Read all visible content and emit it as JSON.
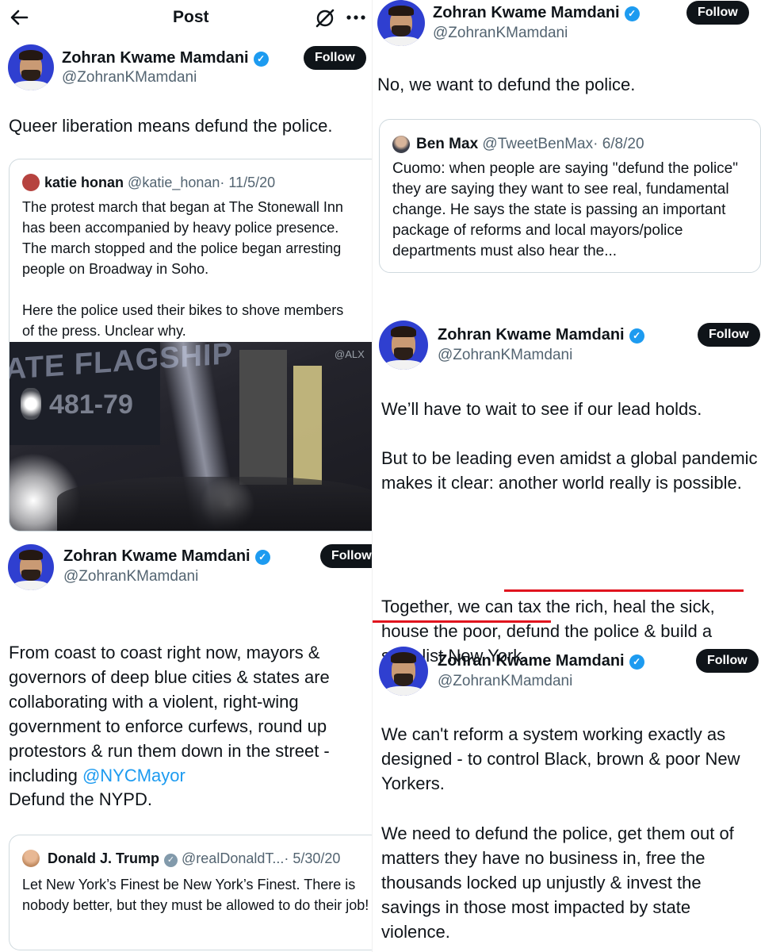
{
  "header": {
    "title": "Post",
    "back_icon": "arrow-left-icon",
    "grok_icon": "grok-icon",
    "more_icon": "more-icon"
  },
  "author": {
    "name": "Zohran Kwame Mamdani",
    "handle": "@ZohranKMamdani",
    "follow_label": "Follow"
  },
  "tweet1": {
    "text": "Queer liberation means defund the police.",
    "quote": {
      "name": "katie honan",
      "handle": "@katie_honan",
      "date": "· 11/5/20",
      "text": "The protest march that began at The Stonewall Inn has been accompanied by heavy police presence. The march stopped and the police began arresting people on Broadway in Soho.\n\nHere the police used their bikes to shove members of the press. Unclear why.",
      "media_watermark": "@ALX",
      "media_sign_1": "ATE FLAGSHIP",
      "media_sign_2": "481-79"
    }
  },
  "tweet2": {
    "text_before": "From coast to coast right now, mayors & governors of deep blue cities & states are collaborating with a violent, right-wing government to enforce curfews, round up protestors & run them down in the street - including ",
    "mention": "@NYCMayor",
    "text_after": "Defund the NYPD.",
    "quote": {
      "name": "Donald J. Trump",
      "handle": "@realDonaldT...",
      "date": "· 5/30/20",
      "text": "Let New York’s Finest be New York’s Finest. There is nobody better, but they must be allowed to do their job!"
    }
  },
  "tweet3": {
    "text": "No, we want to defund the police.",
    "quote": {
      "name": "Ben Max",
      "handle": "@TweetBenMax",
      "date": "· 6/8/20",
      "text": "Cuomo: when people are saying \"defund the police\" they are saying they want to see real, fundamental change. He says the state is passing an important package of reforms and local mayors/police departments must also hear the..."
    }
  },
  "tweet4": {
    "p1": "We’ll have to wait to see if our lead holds.",
    "p2": "But to be leading even amidst a global pandemic makes it clear: another world really is possible.",
    "p3a": "Together, we can tax the rich, heal the sick, house the poor",
    "p3b": ", defund the police & build a socialist New York."
  },
  "tweet5": {
    "p1": "We can't reform a system working exactly as designed - to control Black, brown & poor New Yorkers.",
    "p2": "We need to defund the police, get them out of matters they have no business in, free the thousands locked up unjustly & invest the savings in those most impacted by state violence."
  },
  "colors": {
    "accent": "#1d9bf0",
    "underline": "#e0141e",
    "follow_bg": "#0f1419"
  }
}
